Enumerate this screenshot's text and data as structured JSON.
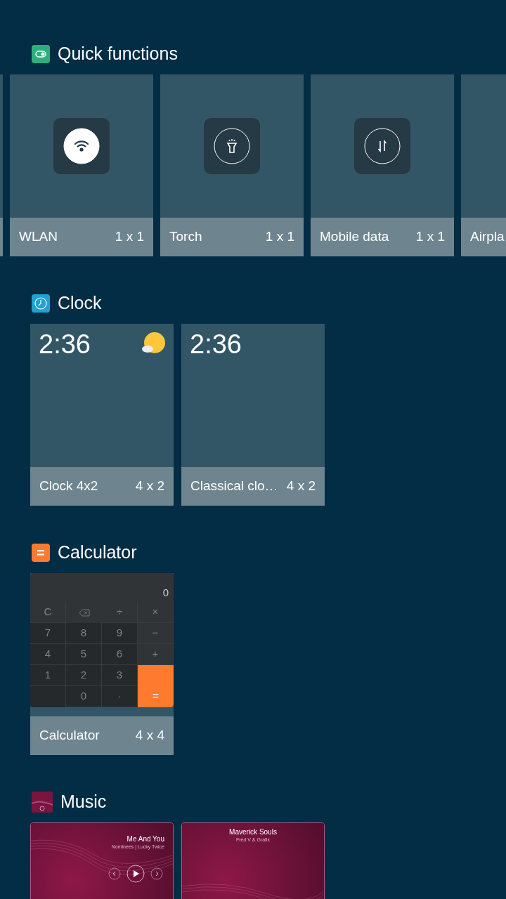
{
  "sections": [
    {
      "title": "Quick functions",
      "kind": "quick",
      "widgets": [
        {
          "label": "WLAN",
          "size": "1 x 1",
          "on": true
        },
        {
          "label": "Torch",
          "size": "1 x 1",
          "on": false
        },
        {
          "label": "Mobile data",
          "size": "1 x 1",
          "on": false
        },
        {
          "label": "Airpla"
        }
      ]
    },
    {
      "title": "Clock",
      "kind": "clock",
      "widgets": [
        {
          "label": "Clock 4x2",
          "size": "4 x 2",
          "time": "2:36",
          "kind": "weather"
        },
        {
          "label": "Classical clo…",
          "size": "4 x 2",
          "time": "2:36",
          "kind": "plain"
        }
      ]
    },
    {
      "title": "Calculator",
      "kind": "calculator",
      "widgets": [
        {
          "label": "Calculator",
          "size": "4 x 4",
          "display": "0",
          "keys": [
            {
              "kind": "top",
              "text": "C"
            },
            {
              "kind": "backspace"
            },
            {
              "kind": "top",
              "text": "÷"
            },
            {
              "kind": "op",
              "text": "×"
            },
            {
              "kind": "num",
              "text": "7"
            },
            {
              "kind": "num",
              "text": "8"
            },
            {
              "kind": "num",
              "text": "9"
            },
            {
              "kind": "op",
              "text": "−"
            },
            {
              "kind": "num",
              "text": "4"
            },
            {
              "kind": "num",
              "text": "5"
            },
            {
              "kind": "num",
              "text": "6"
            },
            {
              "kind": "op",
              "text": "+"
            },
            {
              "kind": "num",
              "text": "1"
            },
            {
              "kind": "num",
              "text": "2"
            },
            {
              "kind": "num",
              "text": "3"
            },
            {
              "kind": "blank"
            },
            {
              "kind": "num",
              "text": "0"
            },
            {
              "kind": "num",
              "text": "·"
            },
            {
              "kind": "equals",
              "text": "="
            }
          ]
        }
      ]
    },
    {
      "title": "Music",
      "kind": "music",
      "widgets": [
        {
          "title": "Me And You",
          "subtitle": "Nominees | Lucky Twice",
          "kind": "player"
        },
        {
          "title": "Maverick Souls",
          "subtitle": "Fred V & Grafix",
          "kind": "centered"
        }
      ]
    }
  ]
}
